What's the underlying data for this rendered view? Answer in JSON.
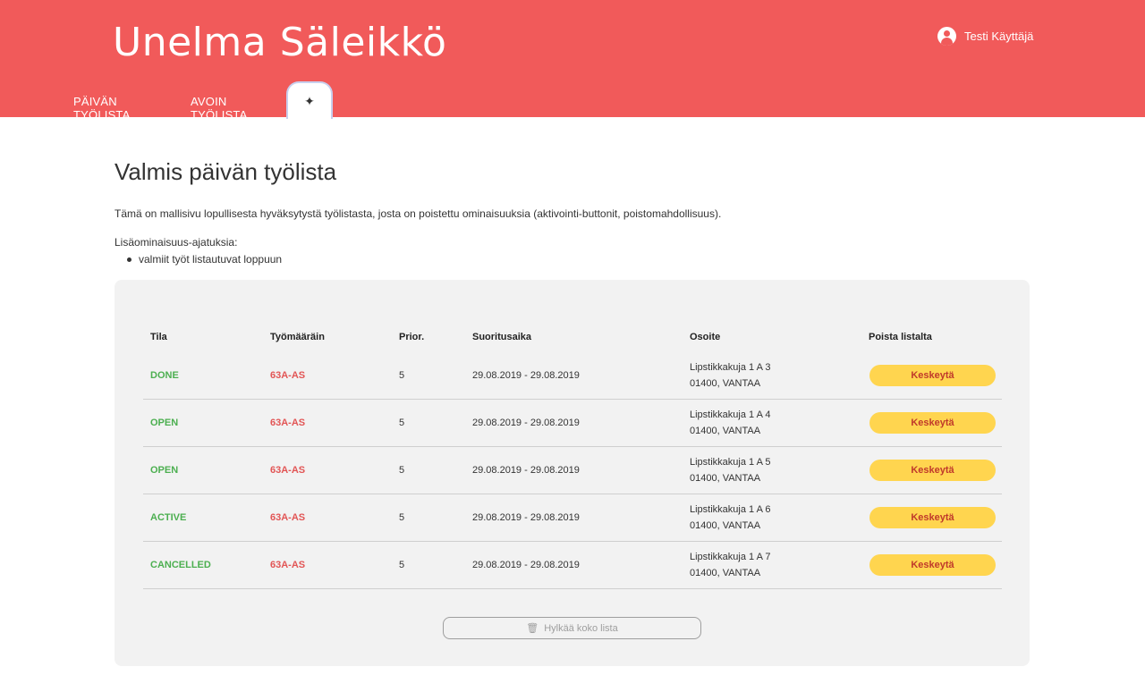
{
  "header": {
    "brand": "Unelma Säleikkö",
    "user_name": "Testi Käyttäjä",
    "nav": {
      "daily_list": "PÄIVÄN TYÖLISTA",
      "open_list": "AVOIN TYÖLISTA",
      "active_tab_icon": "✦"
    }
  },
  "main": {
    "title": "Valmis päivän työlista",
    "intro": "Tämä on mallisivu lopullisesta hyväksytystä työlistasta, josta on poistettu ominaisuuksia (aktivointi-buttonit, poistomahdollisuus).",
    "ideas_label": "Lisäominaisuus-ajatuksia:",
    "ideas": [
      "valmiit työt listautuvat loppuun"
    ]
  },
  "table": {
    "headers": {
      "status": "Tila",
      "order": "Työmääräin",
      "priority": "Prior.",
      "time": "Suoritusaika",
      "address": "Osoite",
      "remove": "Poista listalta"
    },
    "rows": [
      {
        "status": "DONE",
        "order": "63A-AS",
        "priority": "5",
        "time": "29.08.2019 - 29.08.2019",
        "street": "Lipstikkakuja 1 A 3",
        "city": "01400, VANTAA",
        "action": "Keskeytä"
      },
      {
        "status": "OPEN",
        "order": "63A-AS",
        "priority": "5",
        "time": "29.08.2019 - 29.08.2019",
        "street": "Lipstikkakuja 1 A 4",
        "city": "01400, VANTAA",
        "action": "Keskeytä"
      },
      {
        "status": "OPEN",
        "order": "63A-AS",
        "priority": "5",
        "time": "29.08.2019 - 29.08.2019",
        "street": "Lipstikkakuja 1 A 5",
        "city": "01400, VANTAA",
        "action": "Keskeytä"
      },
      {
        "status": "ACTIVE",
        "order": "63A-AS",
        "priority": "5",
        "time": "29.08.2019 - 29.08.2019",
        "street": "Lipstikkakuja 1 A 6",
        "city": "01400, VANTAA",
        "action": "Keskeytä"
      },
      {
        "status": "CANCELLED",
        "order": "63A-AS",
        "priority": "5",
        "time": "29.08.2019 - 29.08.2019",
        "street": "Lipstikkakuja 1 A 7",
        "city": "01400, VANTAA",
        "action": "Keskeytä"
      }
    ],
    "reject_all": "Hylkää koko lista"
  },
  "colors": {
    "brand": "#f15a5a",
    "status": "#4caf50",
    "order": "#e25555",
    "action_button": "#ffd54f"
  },
  "icons": {
    "user": "user-circle-icon",
    "active_tab": "sparkle-icon",
    "reject": "trash-icon"
  }
}
